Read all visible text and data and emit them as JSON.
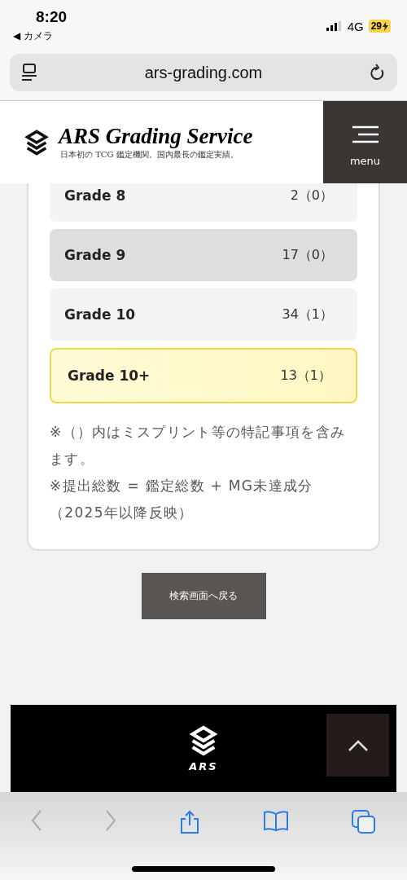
{
  "status_bar": {
    "time": "8:20",
    "back_app": "◀ カメラ",
    "network": "4G",
    "battery": "29"
  },
  "address_bar": {
    "url": "ars-grading.com"
  },
  "header": {
    "brand": "ARS Grading Service",
    "tagline": "日本初の TCG 鑑定機関。国内最長の鑑定実績。",
    "menu_label": "menu"
  },
  "grades": [
    {
      "label": "Grade 8",
      "count": "2（0）",
      "kind": "plain"
    },
    {
      "label": "Grade 9",
      "count": "17（0）",
      "kind": "shaded"
    },
    {
      "label": "Grade 10",
      "count": "34（1）",
      "kind": "plain"
    },
    {
      "label": "Grade 10+",
      "count": "13（1）",
      "kind": "gold"
    }
  ],
  "notes": [
    "※（）内はミスプリント等の特記事項を含みます。",
    "※提出総数 = 鑑定総数 + MG未達成分（2025年以降反映）"
  ],
  "back_button": "検索画面へ戻る",
  "footer": {
    "logo_text": "ARS"
  },
  "toolbar": {
    "back_disabled": true,
    "forward_disabled": true
  }
}
